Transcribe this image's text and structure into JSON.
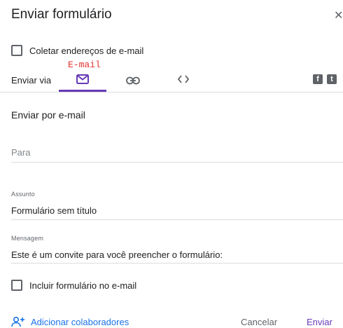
{
  "dialog": {
    "title": "Enviar formulário"
  },
  "collect_emails": {
    "label": "Coletar endereços de e-mail",
    "checked": false
  },
  "send_via": {
    "label": "Enviar via",
    "annotation": "E-mail",
    "tabs": [
      {
        "name": "email",
        "icon": "mail-icon",
        "active": true
      },
      {
        "name": "link",
        "icon": "link-icon",
        "active": false
      },
      {
        "name": "embed",
        "icon": "code-icon",
        "active": false
      }
    ],
    "social": [
      {
        "name": "facebook",
        "glyph": "f"
      },
      {
        "name": "twitter",
        "glyph": "t"
      }
    ]
  },
  "email_form": {
    "section_title": "Enviar por e-mail",
    "to": {
      "placeholder": "Para",
      "value": ""
    },
    "subject": {
      "label": "Assunto",
      "value": "Formulário sem título"
    },
    "message": {
      "label": "Mensagem",
      "value": "Este é um convite para você preencher o formulário:"
    },
    "include_form": {
      "label": "Incluir formulário no e-mail",
      "checked": false
    }
  },
  "footer": {
    "add_collaborators": "Adicionar colaboradores",
    "cancel": "Cancelar",
    "send": "Enviar"
  },
  "colors": {
    "accent": "#673ab7",
    "link": "#1a73e8",
    "annotation": "#e5322d"
  }
}
